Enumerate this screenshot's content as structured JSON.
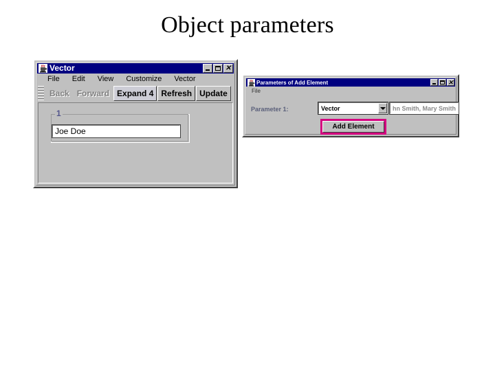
{
  "slide": {
    "title": "Object parameters"
  },
  "vector_window": {
    "title": "Vector",
    "icon": "java-coffee-cup-icon",
    "controls": {
      "minimize": "minimize-icon",
      "maximize": "maximize-icon",
      "close": "close-icon"
    },
    "menu": [
      "File",
      "Edit",
      "View",
      "Customize",
      "Vector"
    ],
    "toolbar": [
      {
        "label": "Back",
        "enabled": false
      },
      {
        "label": "Forward",
        "enabled": false
      },
      {
        "label": "Expand 4",
        "enabled": true
      },
      {
        "label": "Refresh",
        "enabled": true
      },
      {
        "label": "Update",
        "enabled": true
      }
    ],
    "group": {
      "label": "1",
      "value": "Joe Doe"
    }
  },
  "params_window": {
    "title": "Parameters of Add Element",
    "icon": "java-coffee-cup-icon",
    "controls": {
      "minimize": "minimize-icon",
      "maximize": "maximize-icon",
      "close": "close-icon"
    },
    "menu": [
      "File"
    ],
    "parameter_label": "Parameter 1:",
    "combo_value": "Vector",
    "text_value": "hn Smith, Mary Smith",
    "action_button": "Add Element"
  },
  "colors": {
    "titlebar": "#000080",
    "face": "#c0c0c0",
    "highlight": "#d4007f",
    "group_label": "#53568c",
    "param_label": "#5a5f7a"
  }
}
